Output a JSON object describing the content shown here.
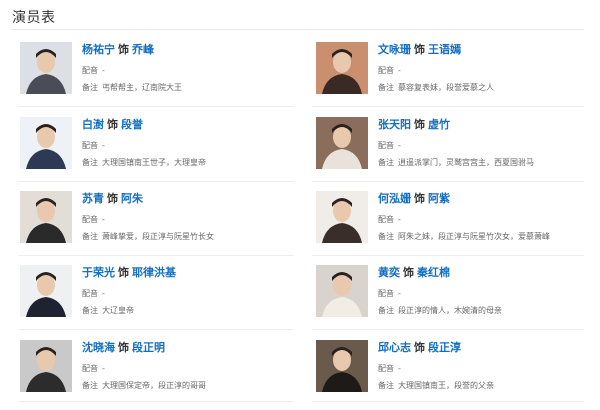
{
  "section_title": "演员表",
  "labels": {
    "as_word": "饰",
    "dub": "配音",
    "note": "备注"
  },
  "cast": [
    {
      "actor": "杨祐宁",
      "role": "乔峰",
      "dub": "-",
      "note": "丐帮帮主，辽南院大王",
      "tone": "#4a4d55",
      "bg": "#dcdfe3"
    },
    {
      "actor": "文咏珊",
      "role": "王语嫣",
      "dub": "-",
      "note": "慕容复表妹，段誉爱慕之人",
      "tone": "#3a2a25",
      "bg": "#c98f6e"
    },
    {
      "actor": "白澍",
      "role": "段誉",
      "dub": "-",
      "note": "大理国镇南王世子，大理皇帝",
      "tone": "#2e3a55",
      "bg": "#eef2f7"
    },
    {
      "actor": "张天阳",
      "role": "虚竹",
      "dub": "-",
      "note": "逍遥派掌门，灵鹫宫宫主，西夏国驸马",
      "tone": "#e8e2da",
      "bg": "#8a6d5a"
    },
    {
      "actor": "苏青",
      "role": "阿朱",
      "dub": "-",
      "note": "萧峰挚爱，段正淳与阮星竹长女",
      "tone": "#2a2a2a",
      "bg": "#e2ddd6"
    },
    {
      "actor": "何泓姗",
      "role": "阿紫",
      "dub": "-",
      "note": "阿朱之妹，段正淳与阮星竹次女，爱慕萧峰",
      "tone": "#3a2e2a",
      "bg": "#f0ece8"
    },
    {
      "actor": "于荣光",
      "role": "耶律洪基",
      "dub": "-",
      "note": "大辽皇帝",
      "tone": "#1f2230",
      "bg": "#eef0f2"
    },
    {
      "actor": "黄奕",
      "role": "秦红棉",
      "dub": "-",
      "note": "段正淳的情人，木婉清的母亲",
      "tone": "#f1ece6",
      "bg": "#d8d3cc"
    },
    {
      "actor": "沈晓海",
      "role": "段正明",
      "dub": "-",
      "note": "大理国保定帝，段正淳的哥哥",
      "tone": "#2c2c2c",
      "bg": "#c9c9c9"
    },
    {
      "actor": "邱心志",
      "role": "段正淳",
      "dub": "-",
      "note": "大理国镇南王，段誉的父亲",
      "tone": "#1e1a18",
      "bg": "#6a5a4c"
    }
  ]
}
